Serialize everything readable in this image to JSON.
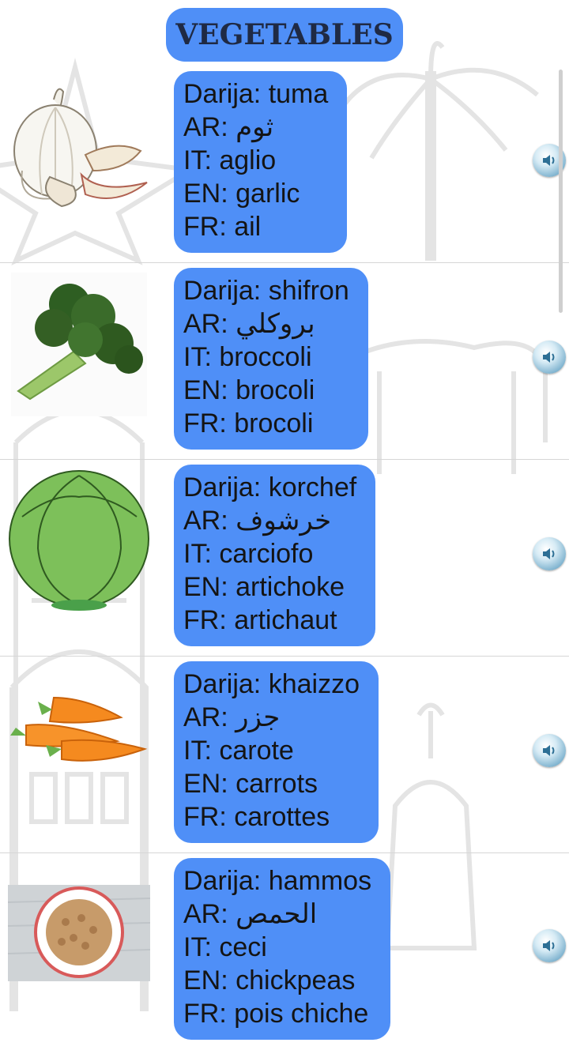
{
  "header": {
    "title": "VEGETABLES"
  },
  "items": [
    {
      "image_icon": "garlic-icon",
      "darija": "Darija: tuma",
      "ar": "AR: ثوم",
      "it": "IT: aglio",
      "en": "EN: garlic",
      "fr": "FR: ail"
    },
    {
      "image_icon": "broccoli-icon",
      "darija": "Darija: shifron",
      "ar": "AR: بروكلي",
      "it": "IT: broccoli",
      "en": "EN: brocoli",
      "fr": "FR: brocoli"
    },
    {
      "image_icon": "cabbage-icon",
      "darija": "Darija: korchef",
      "ar": "AR: خرشوف",
      "it": "IT: carciofo",
      "en": "EN: artichoke",
      "fr": "FR: artichaut"
    },
    {
      "image_icon": "carrots-icon",
      "darija": "Darija: khaizzo",
      "ar": "AR: جزر",
      "it": "IT: carote",
      "en": "EN: carrots",
      "fr": "FR: carottes"
    },
    {
      "image_icon": "chickpeas-icon",
      "darija": "Darija: hammos",
      "ar": "AR: الحمص",
      "it": "IT: ceci",
      "en": "EN: chickpeas",
      "fr": "FR: pois chiche"
    }
  ],
  "colors": {
    "card": "#4f8ff7",
    "title_text": "#1f2a44",
    "divider": "#d6d6d6"
  },
  "icons": {
    "sound": "speaker-icon"
  }
}
